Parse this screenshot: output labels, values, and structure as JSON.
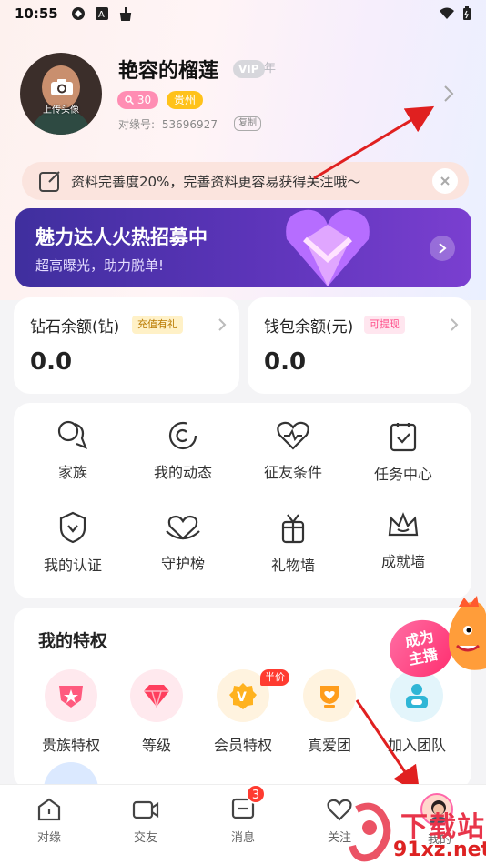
{
  "status": {
    "time": "10:55"
  },
  "profile": {
    "avatar_caption": "上传头像",
    "name": "艳容的榴莲",
    "vip": "VIP",
    "vip_year": "年",
    "level": "30",
    "location": "贵州",
    "uid_label": "对缘号:",
    "uid": "53696927",
    "copy": "复制"
  },
  "notice": {
    "text": "资料完善度20%，完善资料更容易获得关注哦～"
  },
  "banner": {
    "title": "魅力达人火热招募中",
    "subtitle": "超高曝光，助力脱单!"
  },
  "balances": [
    {
      "title": "钻石余额(钻)",
      "badge": "充值有礼",
      "value": "0.0"
    },
    {
      "title": "钱包余额(元)",
      "badge": "可提现",
      "value": "0.0"
    }
  ],
  "grid": [
    {
      "label": "家族",
      "icon": "family-icon"
    },
    {
      "label": "我的动态",
      "icon": "moments-icon"
    },
    {
      "label": "征友条件",
      "icon": "heart-pulse-icon"
    },
    {
      "label": "任务中心",
      "icon": "task-icon"
    },
    {
      "label": "我的认证",
      "icon": "verify-icon"
    },
    {
      "label": "守护榜",
      "icon": "guard-icon"
    },
    {
      "label": "礼物墙",
      "icon": "gift-icon"
    },
    {
      "label": "成就墙",
      "icon": "crown-icon"
    }
  ],
  "privileges": {
    "title": "我的特权",
    "items": [
      {
        "label": "贵族特权"
      },
      {
        "label": "等级"
      },
      {
        "label": "会员特权"
      },
      {
        "label": "真爱团"
      },
      {
        "label": "加入团队"
      }
    ],
    "half_price": "半价",
    "anchor_line1": "成为",
    "anchor_line2": "主播"
  },
  "tabs": [
    {
      "label": "对缘"
    },
    {
      "label": "交友"
    },
    {
      "label": "消息",
      "badge": "3"
    },
    {
      "label": "关注"
    },
    {
      "label": "我的"
    }
  ],
  "watermark": {
    "line1": "下载站",
    "line2": "91xz.net"
  },
  "colors": {
    "accent_pink": "#ff8db3",
    "accent_yellow": "#ffc21a",
    "banner_purple": "#5b34b8",
    "badge_red": "#ff3b30"
  }
}
